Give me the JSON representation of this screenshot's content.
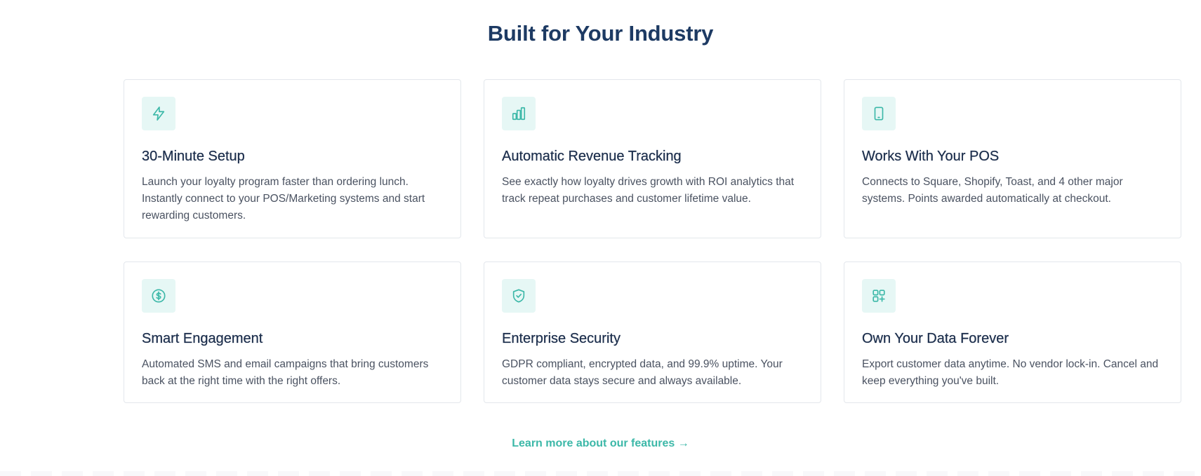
{
  "section": {
    "title": "Built for Your Industry"
  },
  "features": [
    {
      "icon": "lightning-icon",
      "title": "30-Minute Setup",
      "description": "Launch your loyalty program faster than ordering lunch. Instantly connect to your POS/Marketing systems and start rewarding customers."
    },
    {
      "icon": "bar-chart-icon",
      "title": "Automatic Revenue Tracking",
      "description": "See exactly how loyalty drives growth with ROI analytics that track repeat purchases and customer lifetime value."
    },
    {
      "icon": "smartphone-icon",
      "title": "Works With Your POS",
      "description": "Connects to Square, Shopify, Toast, and 4 other major systems. Points awarded automatically at checkout."
    },
    {
      "icon": "dollar-circle-icon",
      "title": "Smart Engagement",
      "description": "Automated SMS and email campaigns that bring customers back at the right time with the right offers."
    },
    {
      "icon": "shield-check-icon",
      "title": "Enterprise Security",
      "description": "GDPR compliant, encrypted data, and 99.9% uptime. Your customer data stays secure and always available."
    },
    {
      "icon": "grid-plus-icon",
      "title": "Own Your Data Forever",
      "description": "Export customer data anytime. No vendor lock-in. Cancel and keep everything you've built."
    }
  ],
  "cta": {
    "label": "Learn more about our features →"
  },
  "colors": {
    "heading": "#1d3a63",
    "accent": "#3cb8a8",
    "icon_bg": "#e6f7f5"
  }
}
